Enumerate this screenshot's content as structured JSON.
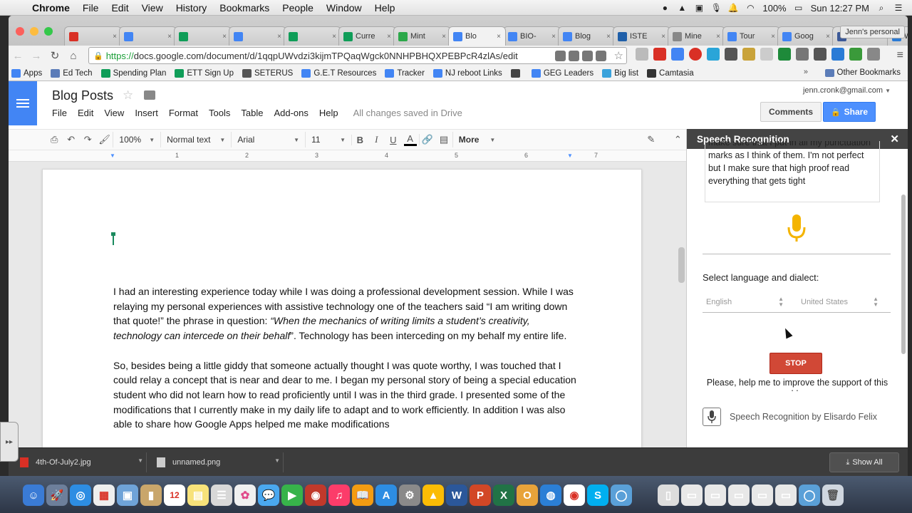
{
  "mac_menu": {
    "app": "Chrome",
    "items": [
      "File",
      "Edit",
      "View",
      "History",
      "Bookmarks",
      "People",
      "Window",
      "Help"
    ],
    "battery": "100%",
    "clock": "Sun 12:27 PM"
  },
  "browser": {
    "tabs": [
      {
        "label": "",
        "color": "#d93025"
      },
      {
        "label": "",
        "color": "#4285f4"
      },
      {
        "label": "",
        "color": "#0f9d58"
      },
      {
        "label": "",
        "color": "#4285f4"
      },
      {
        "label": "",
        "color": "#0f9d58"
      },
      {
        "label": "Curre",
        "color": "#0f9d58"
      },
      {
        "label": "Mint",
        "color": "#2ca84a"
      },
      {
        "label": "Blo",
        "color": "#4285f4"
      },
      {
        "label": "BIO-",
        "color": "#4285f4"
      },
      {
        "label": "Blog",
        "color": "#4285f4"
      },
      {
        "label": "ISTE",
        "color": "#1f5fa9"
      },
      {
        "label": "Mine",
        "color": "#888888"
      },
      {
        "label": "Tour",
        "color": "#4285f4"
      },
      {
        "label": "Goog",
        "color": "#4285f4"
      },
      {
        "label": "Jenn",
        "color": "#3b5998"
      },
      {
        "label": "Weeb",
        "color": "#2b7bd6"
      }
    ],
    "profile": "Jenn's personal",
    "url_scheme": "https://",
    "url_rest": "docs.google.com/document/d/1qqpUWvdzi3kijmTPQaqWgck0NNHPBHQXPEBPcR4zlAs/edit",
    "bookmarks": [
      {
        "label": "Apps",
        "color": "#4285f4"
      },
      {
        "label": "Ed Tech",
        "color": "#5b7cb8"
      },
      {
        "label": "Spending Plan",
        "color": "#0f9d58"
      },
      {
        "label": "ETT Sign Up",
        "color": "#0f9d58"
      },
      {
        "label": "SETERUS",
        "color": "#555555"
      },
      {
        "label": "G.E.T Resources",
        "color": "#4285f4"
      },
      {
        "label": "Tracker",
        "color": "#4285f4"
      },
      {
        "label": "NJ reboot Links",
        "color": "#4285f4"
      },
      {
        "label": "",
        "color": "#444444"
      },
      {
        "label": "GEG Leaders",
        "color": "#4285f4"
      },
      {
        "label": "Big list",
        "color": "#3aa2db"
      },
      {
        "label": "Camtasia",
        "color": "#333333"
      }
    ],
    "bookmarks_more": "»",
    "other_bookmarks": "Other Bookmarks"
  },
  "doc": {
    "title": "Blog Posts",
    "menu": [
      "File",
      "Edit",
      "View",
      "Insert",
      "Format",
      "Tools",
      "Table",
      "Add-ons",
      "Help"
    ],
    "saved_status": "All changes saved in Drive",
    "account": "jenn.cronk@gmail.com",
    "comments_label": "Comments",
    "share_label": "Share",
    "toolbar": {
      "zoom": "100%",
      "style": "Normal text",
      "font": "Arial",
      "size": "11",
      "bold": "B",
      "italic": "I",
      "underline": "U",
      "text_color": "A",
      "more": "More"
    },
    "ruler_numbers": [
      "1",
      "2",
      "3",
      "4",
      "5",
      "6",
      "7"
    ],
    "para1": {
      "part1": "I had an interesting experience today while I was doing a professional development session. While I was relaying my personal experiences with assistive technology one of the teachers said “I am writing down that quote!”  the phrase in question: ",
      "quote": "“When the mechanics of writing limits a student’s creativity, technology can intercede on their behalf",
      "part2": "”.   Technology has been interceding on my behalf my entire life."
    },
    "para2": "So, besides being a little giddy that someone actually thought I was quote worthy, I was touched that I could relay a concept that is near and dear to me.  I began my personal story of being a special education student who did not learn how to read proficiently until I was in the third grade.  I presented some of the modifications that I currently make in my daily life to adapt and to work efficiently.  In addition I was also able to share how Google Apps helped me make modifications"
  },
  "speech": {
    "header": "Speech Recognition",
    "close": "✕",
    "transcript": "make sure that I put in all my punctuation marks as I think of them. I'm not perfect but I make sure that high proof read everything that gets tight",
    "language_label": "Select language and dialect:",
    "language": "English",
    "dialect": "United States",
    "stop_label": "STOP",
    "help_text": "Please, help me to improve the support of this add-on",
    "footer": "Speech Recognition by Elisardo Felix",
    "mic_color": "#f4b400"
  },
  "downloads": {
    "items": [
      "4th-Of-July2.jpg",
      "unnamed.png"
    ],
    "show_all": "Show All"
  }
}
